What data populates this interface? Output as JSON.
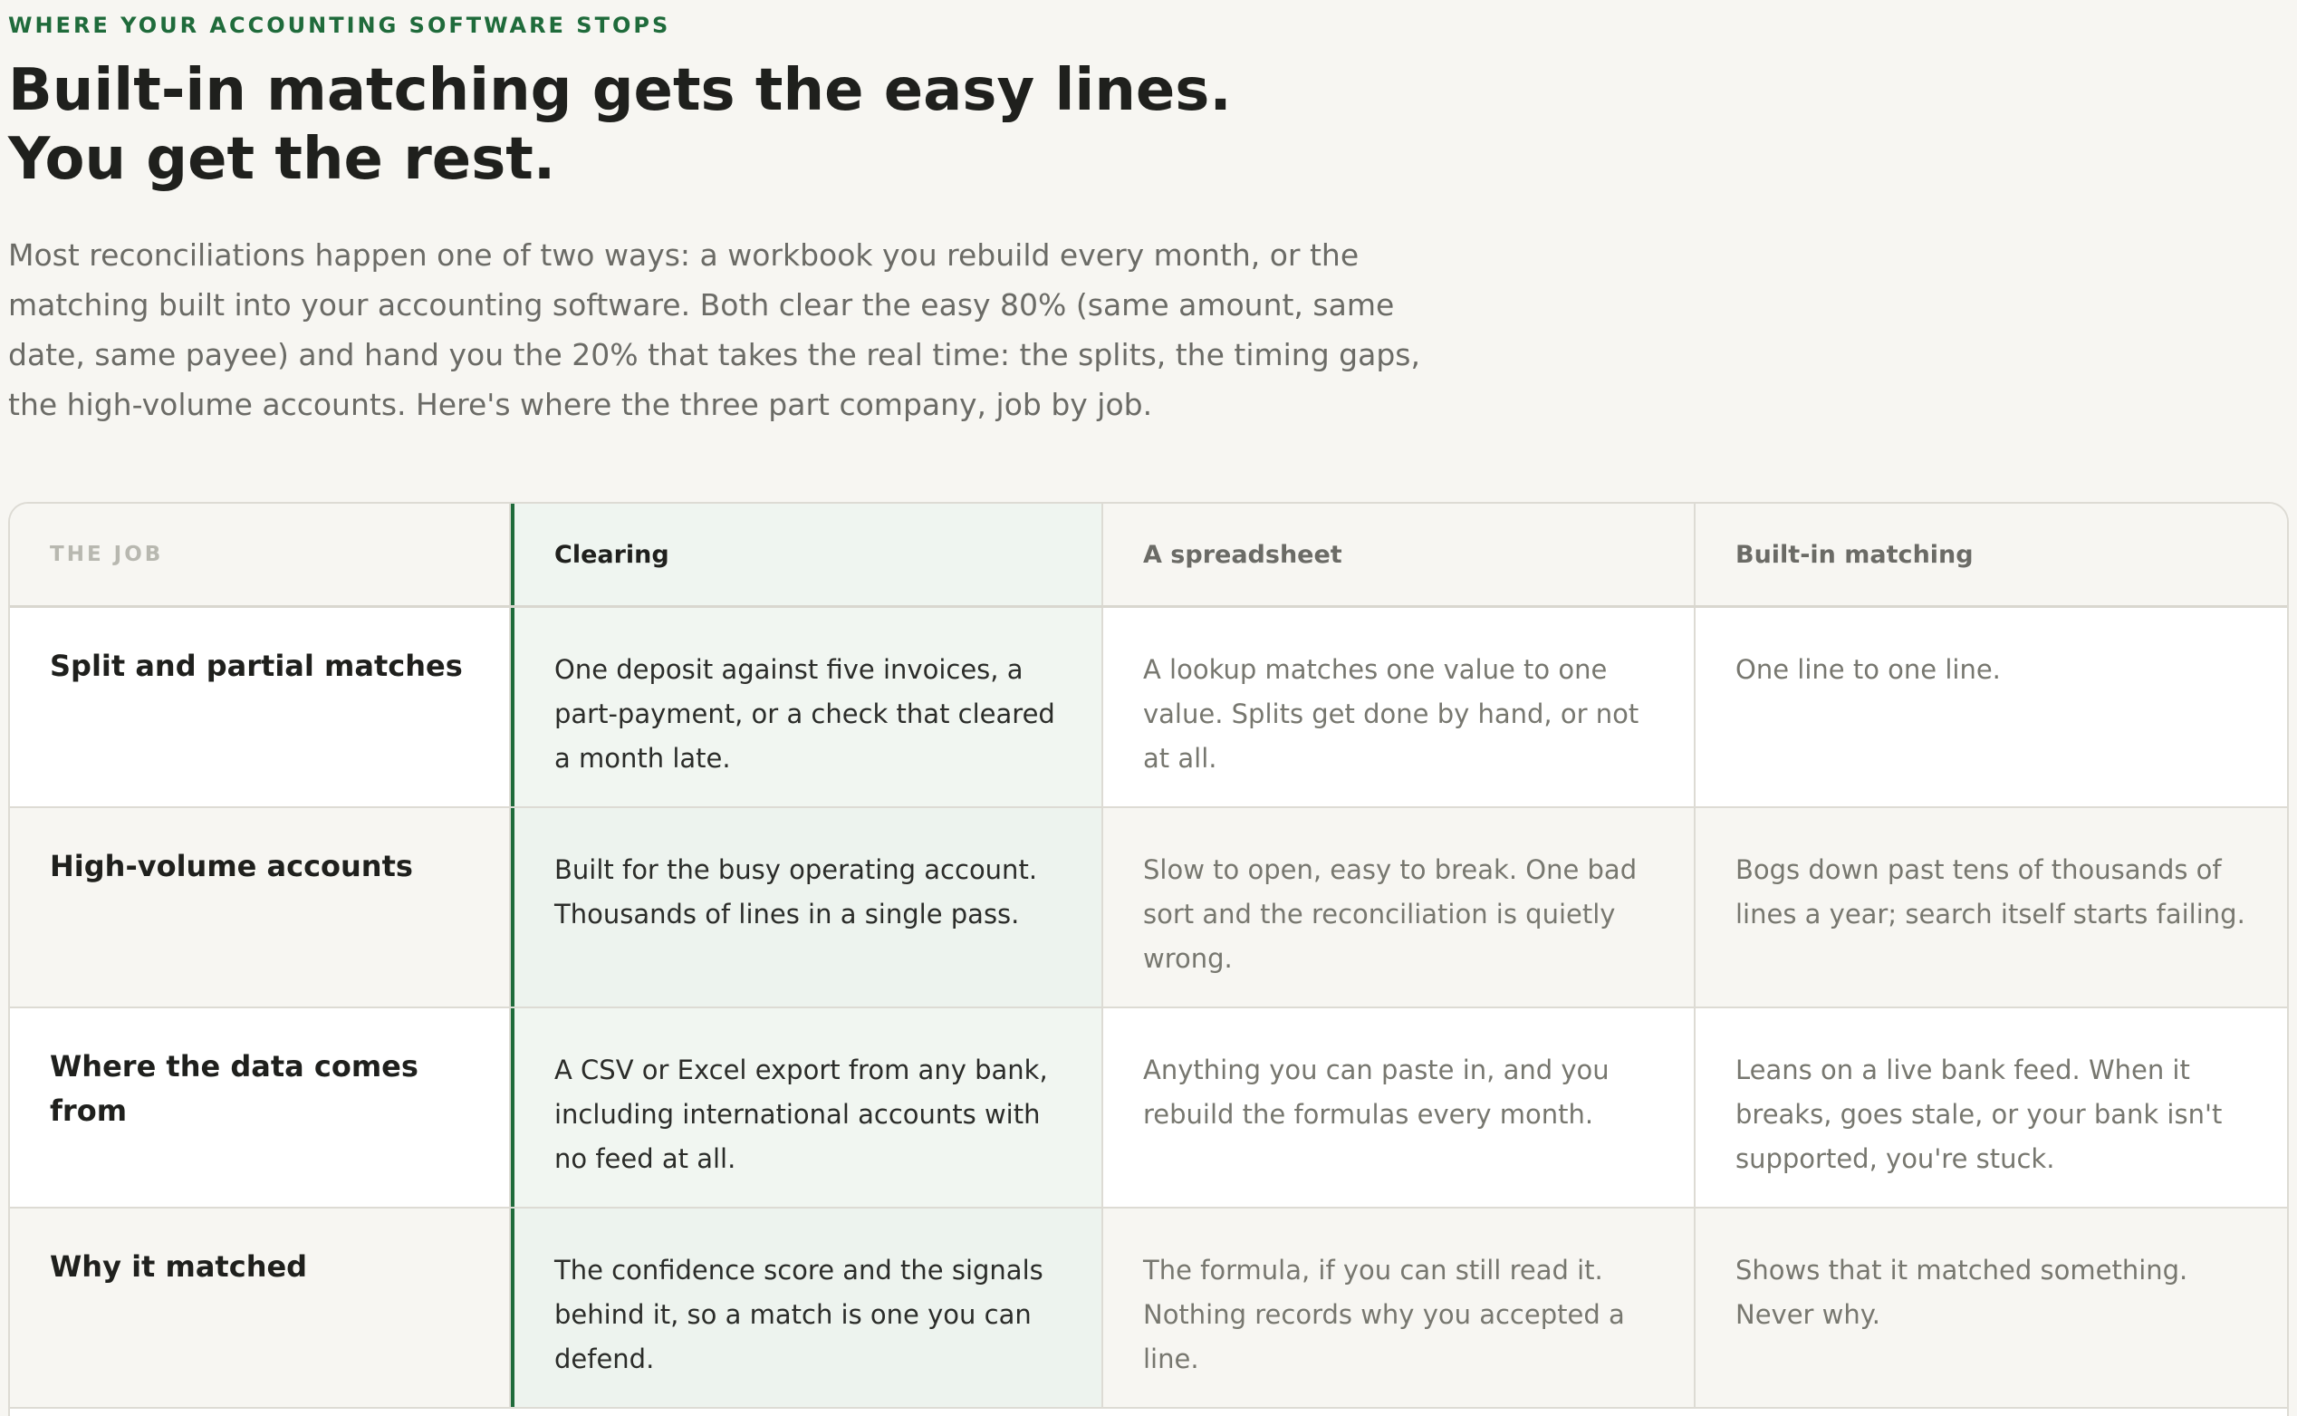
{
  "eyebrow": "WHERE YOUR ACCOUNTING SOFTWARE STOPS",
  "headline": "Built-in matching gets the easy lines. You get the rest.",
  "intro": "Most reconciliations happen one of two ways: a workbook you rebuild every month, or the matching built into your accounting software. Both clear the easy 80% (same amount, same date, same payee) and hand you the 20% that takes the real time: the splits, the timing gaps, the high-volume accounts. Here's where the three part company, job by job.",
  "colors": {
    "accent": "#1f6b3b",
    "background": "#f7f6f2",
    "clearing_column": "#f1f6f1",
    "border": "#dddbd4"
  },
  "table": {
    "headers": {
      "job": "THE JOB",
      "clearing": "Clearing",
      "spreadsheet": "A spreadsheet",
      "builtin": "Built-in matching"
    },
    "rows": [
      {
        "job": "Split and partial matches",
        "clearing": "One deposit against five invoices, a part-payment, or a check that cleared a month late.",
        "spreadsheet": "A lookup matches one value to one value. Splits get done by hand, or not at all.",
        "builtin": "One line to one line."
      },
      {
        "job": "High-volume accounts",
        "clearing": "Built for the busy operating account. Thousands of lines in a single pass.",
        "spreadsheet": "Slow to open, easy to break. One bad sort and the reconciliation is quietly wrong.",
        "builtin": "Bogs down past tens of thousands of lines a year; search itself starts failing."
      },
      {
        "job": "Where the data comes from",
        "clearing": "A CSV or Excel export from any bank, including international accounts with no feed at all.",
        "spreadsheet": "Anything you can paste in, and you rebuild the formulas every month.",
        "builtin": "Leans on a live bank feed. When it breaks, goes stale, or your bank isn't supported, you're stuck."
      },
      {
        "job": "Why it matched",
        "clearing": "The confidence score and the signals behind it, so a match is one you can defend.",
        "spreadsheet": "The formula, if you can still read it. Nothing records why you accepted a line.",
        "builtin": "Shows that it matched something. Never why."
      }
    ]
  }
}
